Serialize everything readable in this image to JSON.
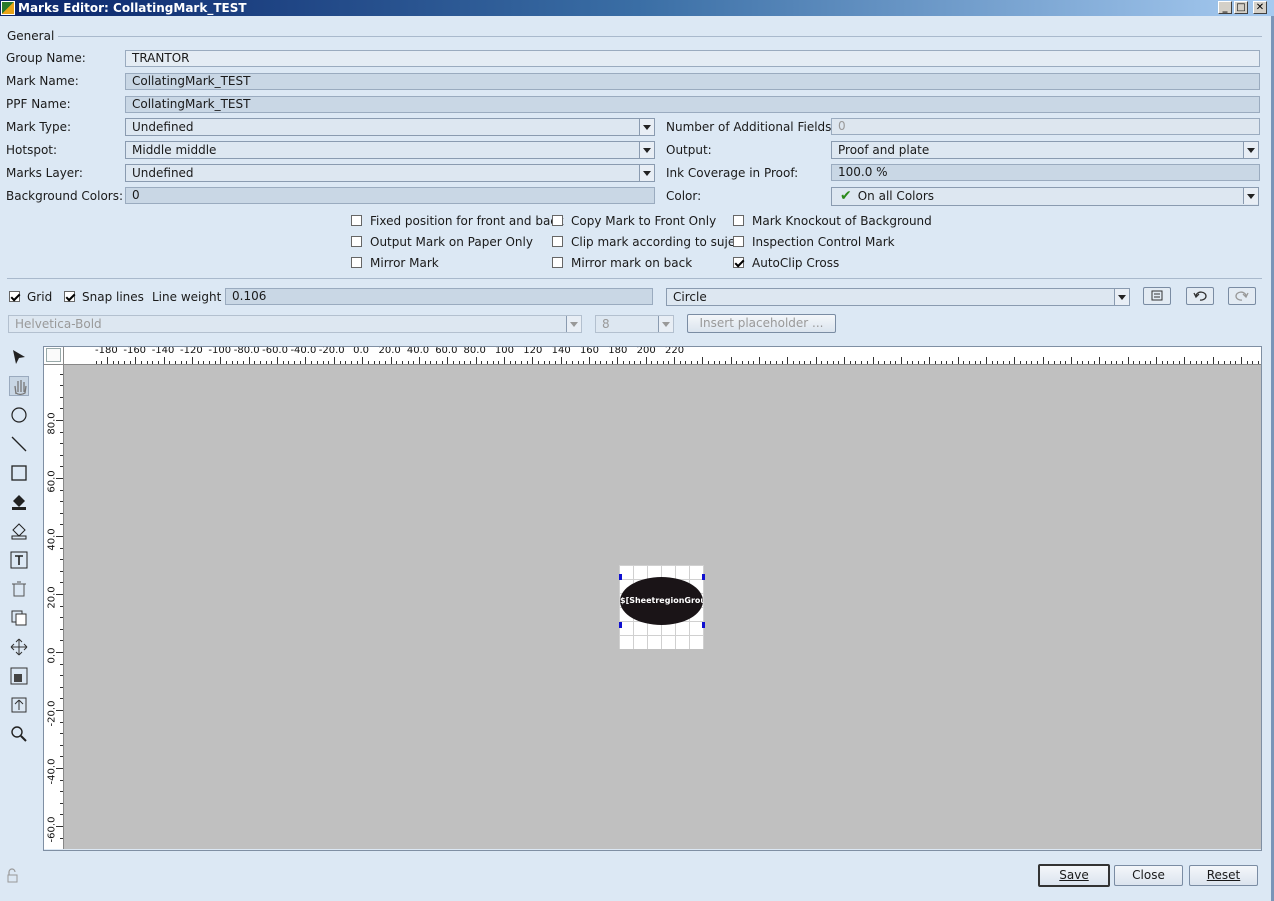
{
  "window": {
    "title": "Marks Editor: CollatingMark_TEST"
  },
  "general": {
    "section_title": "General",
    "group_name_label": "Group Name:",
    "group_name": "TRANTOR",
    "mark_name_label": "Mark Name:",
    "mark_name": "CollatingMark_TEST",
    "ppf_name_label": "PPF Name:",
    "ppf_name": "CollatingMark_TEST",
    "mark_type_label": "Mark Type:",
    "mark_type": "Undefined",
    "hotspot_label": "Hotspot:",
    "hotspot": "Middle middle",
    "marks_layer_label": "Marks Layer:",
    "marks_layer": "Undefined",
    "bg_colors_label": "Background Colors:",
    "bg_colors": "0",
    "num_fields_label": "Number of Additional Fields:",
    "num_fields": "0",
    "output_label": "Output:",
    "output": "Proof and plate",
    "ink_label": "Ink Coverage in Proof:",
    "ink": "100.0 %",
    "color_label": "Color:",
    "color": "On all Colors"
  },
  "options": {
    "fixed_position": {
      "label": "Fixed position for front and back",
      "checked": false
    },
    "copy_front": {
      "label": "Copy Mark to Front Only",
      "checked": false
    },
    "knockout": {
      "label": "Mark Knockout of Background",
      "checked": false
    },
    "paper_only": {
      "label": "Output Mark on Paper Only",
      "checked": false
    },
    "clip_sujet": {
      "label": "Clip mark according to sujet",
      "checked": false
    },
    "inspection": {
      "label": "Inspection Control Mark",
      "checked": false
    },
    "mirror": {
      "label": "Mirror Mark",
      "checked": false
    },
    "mirror_back": {
      "label": "Mirror mark on back",
      "checked": false
    },
    "autoclip": {
      "label": "AutoClip Cross",
      "checked": true
    }
  },
  "toolbar": {
    "grid_label": "Grid",
    "grid_checked": true,
    "snap_label": "Snap lines",
    "snap_checked": true,
    "line_weight_label": "Line weight",
    "line_weight": "0.106",
    "shape": "Circle",
    "font": "Helvetica-Bold",
    "font_size": "8",
    "insert_placeholder": "Insert placeholder ..."
  },
  "ruler": {
    "top": [
      "-180",
      "-160",
      "-140",
      "-120",
      "-100",
      "-80.0",
      "-60.0",
      "-40.0",
      "-20.0",
      "0.0",
      "20.0",
      "40.0",
      "60.0",
      "80.0",
      "100",
      "120",
      "140",
      "160",
      "180",
      "200",
      "220"
    ],
    "left": [
      "80.0",
      "60.0",
      "40.0",
      "20.0",
      "0.0",
      "-20.0",
      "-40.0",
      "-60.0"
    ]
  },
  "mark": {
    "text": "$[SheetregionGroups"
  },
  "tools": [
    "select-tool-icon",
    "hand-tool-icon",
    "ellipse-tool-icon",
    "line-tool-icon",
    "rectangle-tool-icon",
    "fill-tool-icon",
    "stroke-tool-icon",
    "text-tool-icon",
    "delete-icon",
    "duplicate-icon",
    "move-icon",
    "group-icon",
    "bring-front-icon",
    "zoom-icon"
  ],
  "buttons": {
    "save": "Save",
    "close": "Close",
    "reset": "Reset"
  }
}
